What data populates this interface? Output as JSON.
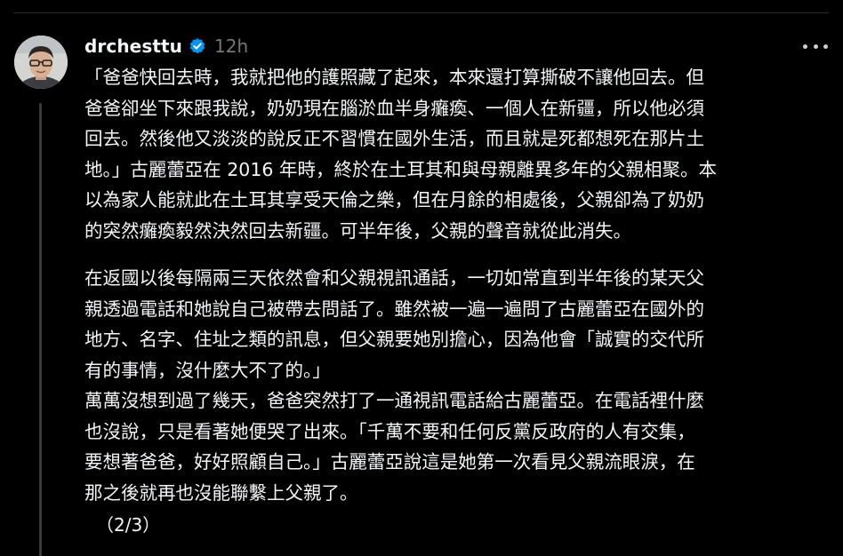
{
  "post": {
    "username": "drchesttu",
    "verified": true,
    "timestamp": "12h",
    "paragraph1": "「爸爸快回去時，我就把他的護照藏了起來，本來還打算撕破不讓他回去。但\n爸爸卻坐下來跟我說，奶奶現在腦淤血半身癱瘓、一個人在新疆，所以他必須\n回去。然後他又淡淡的說反正不習慣在國外生活，而且就是死都想死在那片土\n地。」古麗蕾亞在 2016 年時，終於在土耳其和與母親離異多年的父親相聚。本\n以為家人能就此在土耳其享受天倫之樂，但在月餘的相處後，父親卻為了奶奶\n的突然癱瘓毅然決然回去新疆。可半年後，父親的聲音就從此消失。",
    "paragraph2": "在返國以後每隔兩三天依然會和父親視訊通話，一切如常直到半年後的某天父\n親透過電話和她說自己被帶去問話了。雖然被一遍一遍問了古麗蕾亞在國外的\n地方、名字、住址之類的訊息，但父親要她別擔心，因為他會「誠實的交代所\n有的事情，沒什麼大不了的。」\n萬萬沒想到過了幾天，爸爸突然打了一通視訊電話給古麗蕾亞。在電話裡什麼\n也沒說，只是看著她便哭了出來。「千萬不要和任何反黨反政府的人有交集，\n要想著爸爸，好好照顧自己。」古麗蕾亞說這是她第一次看見父親流眼淚，在\n那之後就再也沒能聯繫上父親了。",
    "page_indicator": "（2/3）"
  },
  "icons": {
    "verified": "verified-badge-icon",
    "more": "more-options-icon",
    "avatar": "user-avatar"
  },
  "colors": {
    "background": "#000000",
    "text": "#f3f5f7",
    "muted": "#777777",
    "verified": "#0095f6",
    "thread_line": "#3a3a3a"
  }
}
